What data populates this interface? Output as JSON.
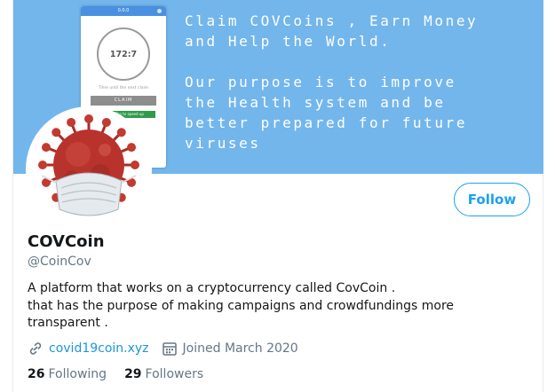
{
  "banner": {
    "phone": {
      "header": "0.0.0",
      "timer": "172:7",
      "subtitle": "Time until the next claim",
      "claim_label": "CLAIM",
      "green_label": "Tap to speed up"
    },
    "text": "Claim COVCoins , Earn Money\nand Help the World.\n\nOur purpose is to improve\nthe Health system and be\nbetter prepared for future\nviruses"
  },
  "profile": {
    "name": "COVCoin",
    "handle": "@CoinCov",
    "bio_lines": [
      "A platform that works on a cryptocurrency called CovCoin .",
      "that has the purpose of making campaigns and crowdfundings more",
      "transparent ."
    ],
    "website": "covid19coin.xyz",
    "joined": "Joined March 2020",
    "following_count": "26",
    "following_label": "Following",
    "followers_count": "29",
    "followers_label": "Followers",
    "follow_button": "Follow"
  },
  "colors": {
    "accent": "#1da1f2",
    "banner": "#73b6ec",
    "virus_red": "#b8332c",
    "mask": "#dfe6ea"
  },
  "icons": [
    "link-icon",
    "calendar-icon"
  ]
}
